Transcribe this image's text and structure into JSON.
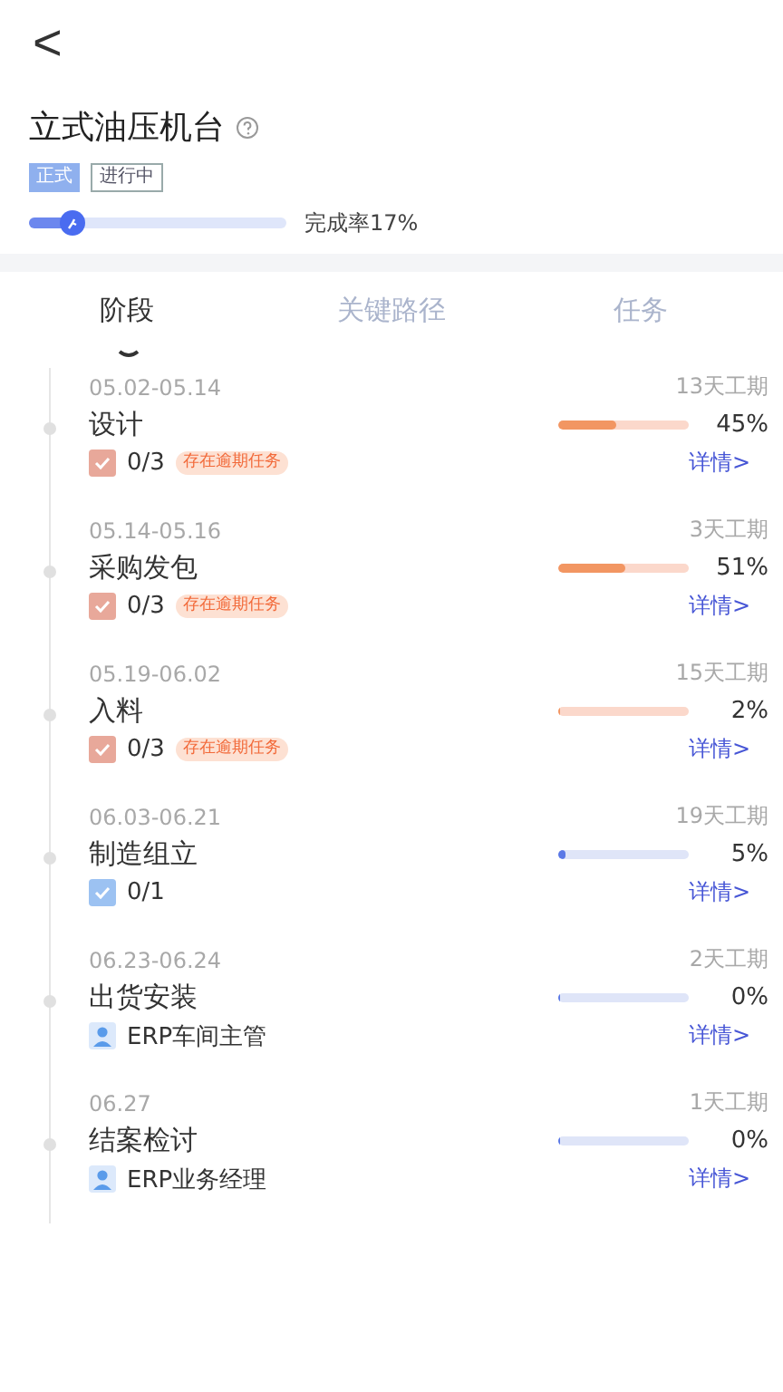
{
  "header": {
    "back": "<"
  },
  "project": {
    "title": "立式油压机台",
    "tags": [
      {
        "label": "正式",
        "kind": "filled"
      },
      {
        "label": "进行中",
        "kind": "outline"
      }
    ],
    "progress": {
      "level": 0.17,
      "label": "完成率17%"
    }
  },
  "tabs": [
    {
      "label": "阶段",
      "selected": true
    },
    {
      "label": "关键路径",
      "selected": false
    },
    {
      "label": "任务",
      "selected": false
    }
  ],
  "stages": [
    {
      "dates": "05.02-05.14",
      "name": "设计",
      "duration": "13天工期",
      "level": 0.45,
      "percent": "45%",
      "overdue": true,
      "kind": "tasks",
      "info": "0/3",
      "warning": "存在逾期任务",
      "link": "详情>"
    },
    {
      "dates": "05.14-05.16",
      "name": "采购发包",
      "duration": "3天工期",
      "level": 0.51,
      "percent": "51%",
      "overdue": true,
      "kind": "tasks",
      "info": "0/3",
      "warning": "存在逾期任务",
      "link": "详情>"
    },
    {
      "dates": "05.19-06.02",
      "name": "入料",
      "duration": "15天工期",
      "level": 0.02,
      "percent": "2%",
      "overdue": true,
      "kind": "tasks",
      "info": "0/3",
      "warning": "存在逾期任务",
      "link": "详情>"
    },
    {
      "dates": "06.03-06.21",
      "name": "制造组立",
      "duration": "19天工期",
      "level": 0.05,
      "percent": "5%",
      "overdue": false,
      "kind": "tasks",
      "info": "0/1",
      "link": "详情>"
    },
    {
      "dates": "06.23-06.24",
      "name": "出货安装",
      "duration": "2天工期",
      "level": 0,
      "percent": "0%",
      "overdue": false,
      "kind": "owner",
      "info": "ERP车间主管",
      "link": "详情>"
    },
    {
      "dates": "06.27",
      "name": "结案检讨",
      "duration": "1天工期",
      "level": 0,
      "percent": "0%",
      "overdue": false,
      "kind": "owner",
      "info": "ERP业务经理",
      "link": "详情>"
    }
  ]
}
